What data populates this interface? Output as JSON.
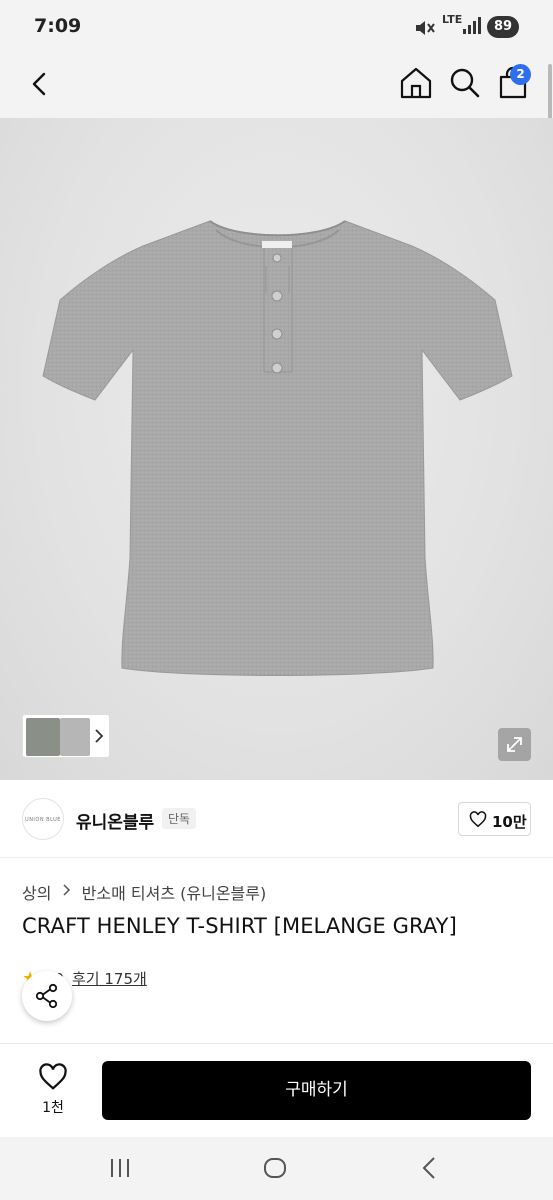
{
  "status_bar": {
    "time": "7:09",
    "network": "LTE",
    "battery": "89",
    "icons": [
      "mute-icon",
      "signal-icon"
    ]
  },
  "top_bar": {
    "icons": [
      "back-icon",
      "home-icon",
      "search-icon",
      "cart-icon"
    ],
    "cart_count": "2"
  },
  "product_image": {
    "subject": "grey henley t-shirt",
    "color": "#a9a9a9",
    "icons": [
      "chevron-right-icon",
      "expand-icon"
    ]
  },
  "brand": {
    "logo_text": "UNION BLUE",
    "name": "유니온블루",
    "tag": "단독",
    "likes": "10만"
  },
  "breadcrumb": {
    "category": "상의",
    "subcategory": "반소매 티셔츠 (유니온블루)"
  },
  "product": {
    "title": "CRAFT HENLEY T-SHIRT [MELANGE GRAY]",
    "rating": "4.9",
    "reviews_label": "후기 175개"
  },
  "swatches": [
    {
      "color": "#bdbdbd",
      "selected": true
    },
    {
      "color": "#1a1a1a",
      "selected": false
    },
    {
      "color": "#f4f4f4",
      "selected": false
    }
  ],
  "bottom_bar": {
    "wishlist_count": "1천",
    "buy_label": "구매하기"
  },
  "system_nav": {
    "icons": [
      "recent-apps-icon",
      "home-circle-icon",
      "back-arrow-icon"
    ]
  }
}
